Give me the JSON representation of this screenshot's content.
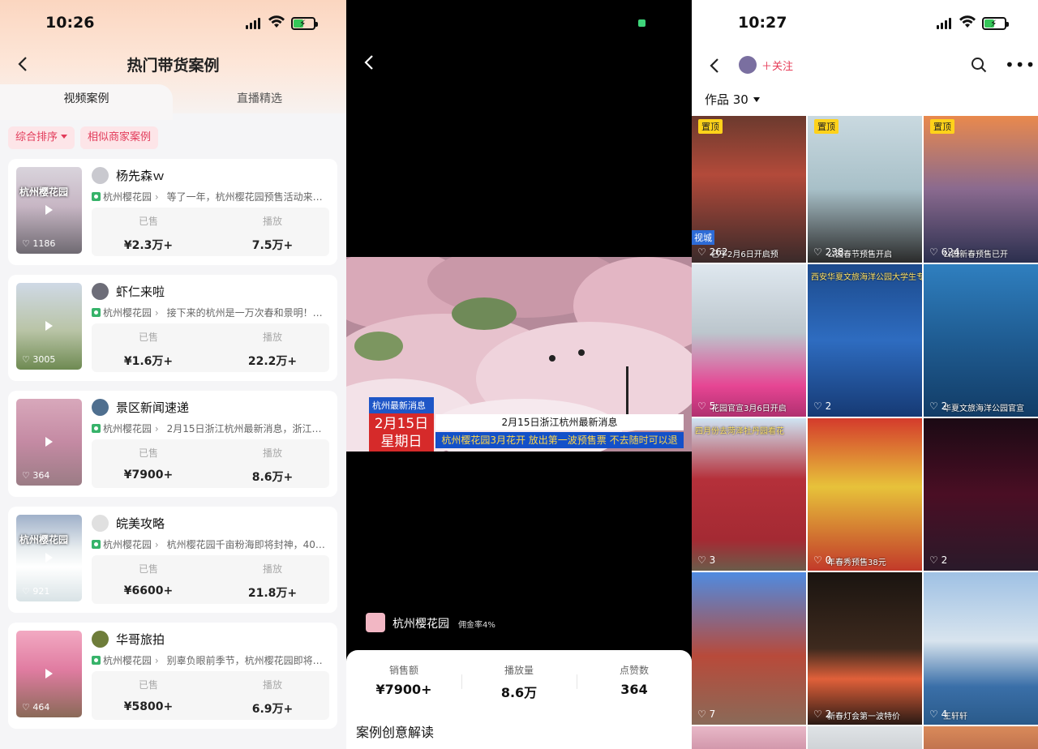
{
  "screen1": {
    "time": "10:26",
    "title": "热门带货案例",
    "tabs": [
      "视频案例",
      "直播精选"
    ],
    "chips": {
      "sort": "综合排序",
      "similar": "相似商家案例"
    },
    "sold_label": "已售",
    "play_label": "播放",
    "cards": [
      {
        "user": "杨先森ｗ",
        "location": "杭州樱花园",
        "desc": "等了一年，杭州樱花园预售活动来…",
        "sold": "¥2.3万+",
        "plays": "7.5万+",
        "likes": "1186",
        "thumb_caption": "杭州樱花园"
      },
      {
        "user": "虾仁来啦",
        "location": "杭州樱花园",
        "desc": "接下来的杭州是一万次春和景明！…",
        "sold": "¥1.6万+",
        "plays": "22.2万+",
        "likes": "3005",
        "thumb_caption": ""
      },
      {
        "user": "景区新闻速递",
        "location": "杭州樱花园",
        "desc": "2月15日浙江杭州最新消息，浙江…",
        "sold": "¥7900+",
        "plays": "8.6万+",
        "likes": "364",
        "thumb_caption": ""
      },
      {
        "user": "皖美攻略",
        "location": "杭州樱花园",
        "desc": "杭州樱花园千亩粉海即将封神，40…",
        "sold": "¥6600+",
        "plays": "21.8万+",
        "likes": "921",
        "thumb_caption": "杭州樱花园"
      },
      {
        "user": "华哥旅拍",
        "location": "杭州樱花园",
        "desc": "别辜负眼前季节，杭州樱花园即将…",
        "sold": "¥5800+",
        "plays": "6.9万+",
        "likes": "464",
        "thumb_caption": ""
      }
    ]
  },
  "screen2": {
    "news_header": "杭州最新消息",
    "news_date": "2月15日",
    "news_weekday": "星期日",
    "ticker_top": "2月15日浙江杭州最新消息",
    "ticker_bottom": "杭州樱花园3月花开 放出第一波预售票 不去随时可以退",
    "shop_name": "杭州樱花园",
    "commission": "佣金率4%",
    "stats": [
      {
        "label": "销售额",
        "value": "¥7900+"
      },
      {
        "label": "播放量",
        "value": "8.6万"
      },
      {
        "label": "点赞数",
        "value": "364"
      }
    ],
    "section_title": "案例创意解读"
  },
  "screen3": {
    "time": "10:27",
    "follow": "＋关注",
    "works_label": "作品 30",
    "pinned_label": "置顶",
    "cells": [
      {
        "likes": "262",
        "pinned": true,
        "overlay_top": "",
        "overlay_bottom": "已于2月6日开启预",
        "tag": "视城"
      },
      {
        "likes": "238",
        "pinned": true,
        "overlay_top": "",
        "overlay_bottom": "公园春节预售开启"
      },
      {
        "likes": "624",
        "pinned": true,
        "overlay_top": "",
        "overlay_bottom": "公园新春预售已开"
      },
      {
        "likes": "5",
        "pinned": false,
        "overlay_top": "",
        "overlay_bottom": "花园官宣3月6日开启"
      },
      {
        "likes": "2",
        "pinned": false,
        "overlay_top": "西安华夏文旅海洋公园大学生专享双人票",
        "overlay_bottom": ""
      },
      {
        "likes": "2",
        "pinned": false,
        "overlay_top": "",
        "overlay_bottom": "华夏文旅海洋公园官宣"
      },
      {
        "likes": "3",
        "pinned": false,
        "overlay_top": "四月份去菏泽牡丹园看花",
        "overlay_bottom": ""
      },
      {
        "likes": "0",
        "pinned": false,
        "overlay_top": "",
        "overlay_bottom": "年春秀预售38元"
      },
      {
        "likes": "2",
        "pinned": false,
        "overlay_top": "",
        "overlay_bottom": ""
      },
      {
        "likes": "7",
        "pinned": false,
        "overlay_top": "",
        "overlay_bottom": ""
      },
      {
        "likes": "2",
        "pinned": false,
        "overlay_top": "",
        "overlay_bottom": "新春灯会第一波特价"
      },
      {
        "likes": "4",
        "pinned": false,
        "overlay_top": "",
        "overlay_bottom": "王轩轩"
      }
    ]
  },
  "colors": {
    "accent": "#e23b5a",
    "pin": "#ffd21a",
    "battery": "#35c759"
  }
}
